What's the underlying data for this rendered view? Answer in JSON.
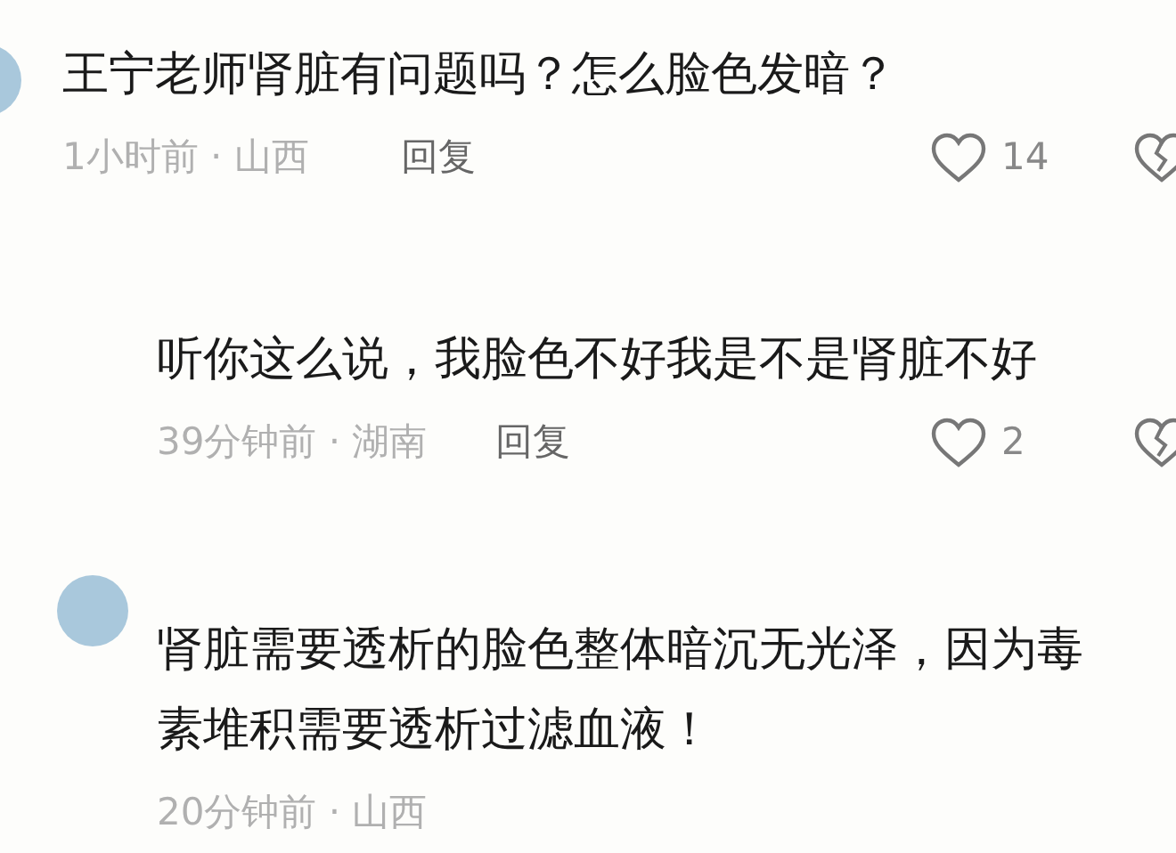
{
  "comments": [
    {
      "text": "王宁老师肾脏有问题吗？怎么脸色发暗？",
      "time_location": "1小时前 · 山西",
      "reply_label": "回复",
      "likes": "14",
      "children": [
        {
          "text": "听你这么说，我脸色不好我是不是肾脏不好",
          "time_location": "39分钟前 · 湖南",
          "reply_label": "回复",
          "likes": "2"
        },
        {
          "text": "肾脏需要透析的脸色整体暗沉无光泽，因为毒素堆积需要透析过滤血液！",
          "time_location": "20分钟前 · 山西"
        }
      ]
    }
  ]
}
